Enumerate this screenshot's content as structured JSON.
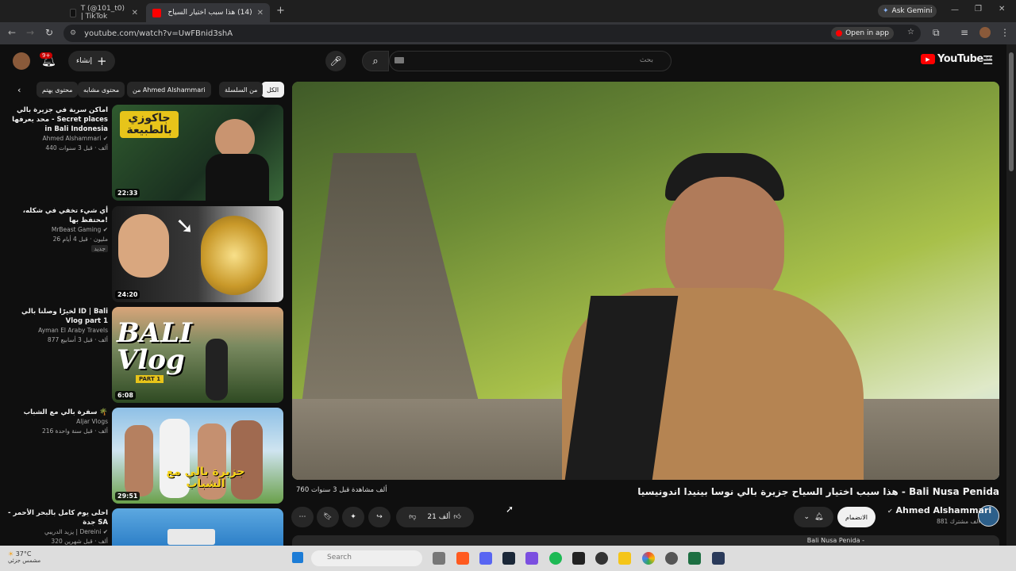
{
  "browser": {
    "tabs": [
      {
        "label": "T (@101_t0) | TikTok"
      },
      {
        "label": "(14) هذا سبب اختيار السياح :-"
      }
    ],
    "ask_gemini": "Ask Gemini",
    "url": "youtube.com/watch?v=UwFBnid3shA",
    "open_in_app": "Open in app"
  },
  "yt": {
    "logo": "YouTube",
    "logo_region": "SA",
    "search_placeholder": "بحث",
    "create_label": "إنشاء",
    "notif_badge": "9+"
  },
  "chips": [
    "الكل",
    "من السلسلة",
    "من Ahmed Alshammari",
    "محتوى مشابه",
    "محتوى يهتم"
  ],
  "recs": [
    {
      "title": "اماكن سرية في جزيرة بالي محد يعرفها - Secret places in Bali Indonesia",
      "channel": "Ahmed Alshammari",
      "stats": "440 ألف · قبل 3 سنوات",
      "duration": "22:33",
      "thumb_text": "جاكوزي بالطبيعة"
    },
    {
      "title": "أي شيء تخفي في شكله، محتفظ بها!",
      "channel": "MrBeast Gaming",
      "stats": "26 مليون · قبل 4 أيام",
      "badge": "جديد",
      "duration": "24:20"
    },
    {
      "title": "لخيرًا وصلنا بالي  ID | Bali Vlog part 1",
      "channel": "Ayman El Araby Travels",
      "stats": "877 ألف · قبل 3 أسابيع",
      "duration": "6:08",
      "thumb_text": "BALI Vlog",
      "thumb_sub": "PART 1"
    },
    {
      "title": "سفرة بالي مع الشباب 🌴",
      "channel": "Aljar Vlogs",
      "stats": "216 ألف · قبل سنة واحدة",
      "duration": "29:51",
      "thumb_text": "جزيرة بالي مع الشباب"
    },
    {
      "title": "احلى يوم كامل بالبحر الأحمر - جدة SA",
      "channel": "يزيد الدريبي | Dereini",
      "stats": "320 ألف · قبل شهرين",
      "duration": ""
    }
  ],
  "video": {
    "title": "هذا سبب اختيار السياح جزيرة بالي نوسا بينيدا اندونيسيا - Bali Nusa Penida",
    "views": "760 ألف مشاهدة قبل 3 سنوات",
    "channel": "Ahmed Alshammari",
    "subs": "881 ألف مشترك",
    "join": "الانضمام",
    "likes": "21 ألف",
    "desc_preview": "Bali Nusa Penida -"
  },
  "taskbar": {
    "search": "Search",
    "weather": "37°C",
    "weather_sub": "مشمس جزئي"
  }
}
